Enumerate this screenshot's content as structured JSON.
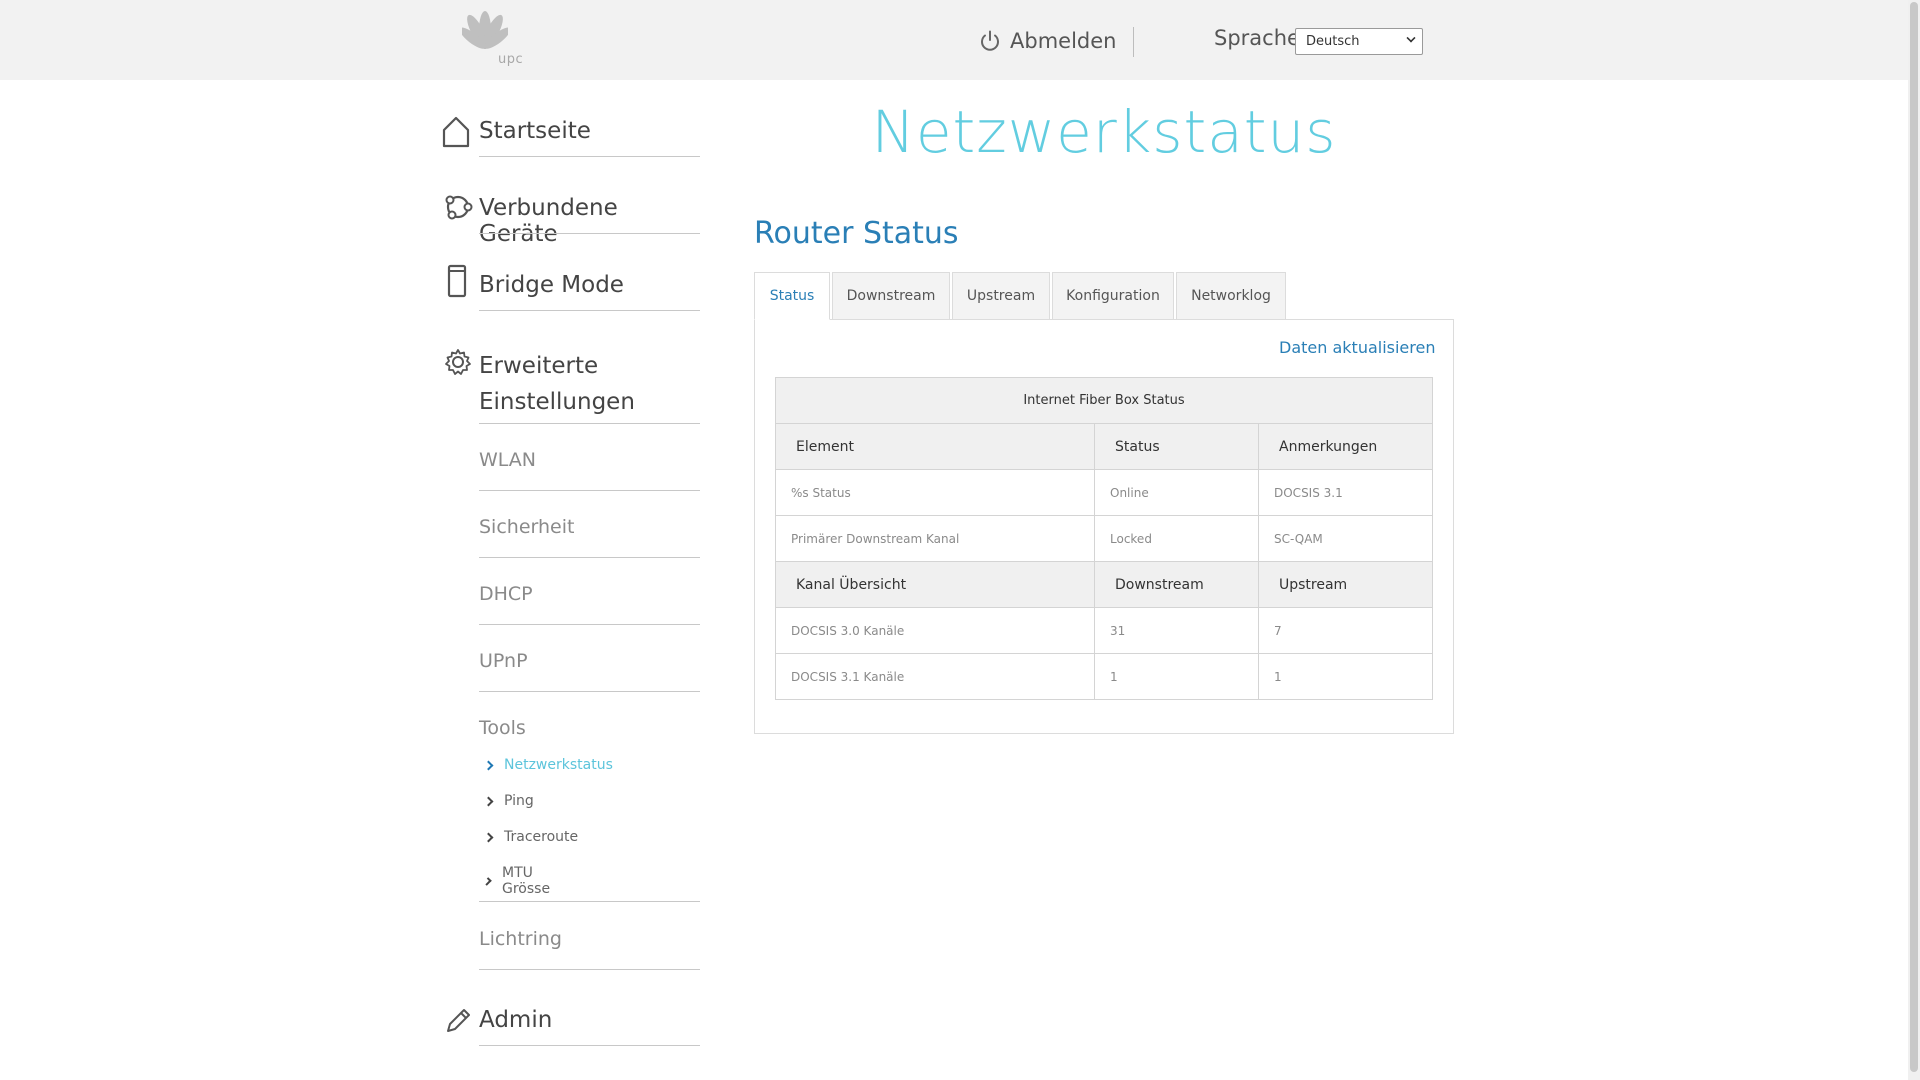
{
  "header": {
    "logo_text": "upc",
    "logout_label": "Abmelden",
    "language_label": "Sprache",
    "language_selected": "Deutsch"
  },
  "sidebar": {
    "main_items": [
      {
        "label": "Startseite",
        "icon": "home-icon"
      },
      {
        "label": "Verbundene Geräte",
        "icon": "devices-icon"
      },
      {
        "label": "Bridge Mode",
        "icon": "bridge-mode-icon"
      },
      {
        "label": "Erweiterte Einstellungen",
        "line1": "Erweiterte",
        "line2": "Einstellungen",
        "icon": "gear-icon"
      },
      {
        "label": "Admin",
        "icon": "pencil-icon"
      }
    ],
    "sub_items": [
      "WLAN",
      "Sicherheit",
      "DHCP",
      "UPnP",
      "Tools",
      "Lichtring"
    ],
    "tools_items": [
      {
        "label": "Netzwerkstatus",
        "active": true
      },
      {
        "label": "Ping",
        "active": false
      },
      {
        "label": "Traceroute",
        "active": false
      },
      {
        "label": "MTU Grösse",
        "active": false
      }
    ]
  },
  "main": {
    "page_title": "Netzwerkstatus",
    "section_title": "Router Status",
    "tabs": [
      "Status",
      "Downstream",
      "Upstream",
      "Konfiguration",
      "Networklog"
    ],
    "active_tab": "Status",
    "refresh_label": "Daten aktualisieren",
    "table": {
      "caption": "Internet Fiber Box Status",
      "header1": [
        "Element",
        "Status",
        "Anmerkungen"
      ],
      "rows1": [
        [
          "%s Status",
          "Online",
          "DOCSIS 3.1"
        ],
        [
          "Primärer Downstream Kanal",
          "Locked",
          "SC-QAM"
        ]
      ],
      "header2": [
        "Kanal Übersicht",
        "Downstream",
        "Upstream"
      ],
      "rows2": [
        [
          "DOCSIS 3.0 Kanäle",
          "31",
          "7"
        ],
        [
          "DOCSIS 3.1 Kanäle",
          "1",
          "1"
        ]
      ]
    }
  },
  "colors": {
    "accent_light": "#62cde0",
    "accent_dark": "#2a7fb6",
    "header_bg": "#f2f2f2"
  }
}
